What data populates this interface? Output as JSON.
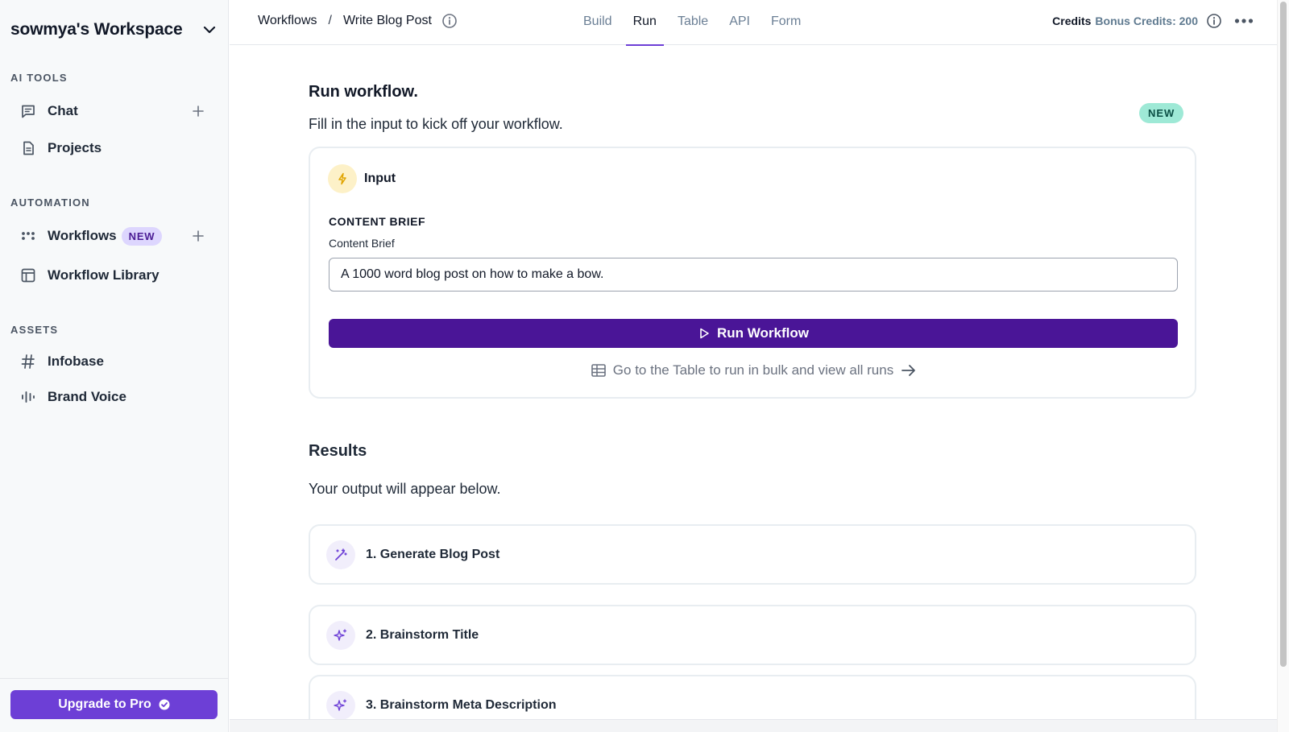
{
  "sidebar": {
    "workspace_name": "sowmya's Workspace",
    "sections": {
      "ai_tools": "AI TOOLS",
      "automation": "AUTOMATION",
      "assets": "ASSETS"
    },
    "items": {
      "chat": "Chat",
      "projects": "Projects",
      "workflows": "Workflows",
      "workflows_badge": "NEW",
      "workflow_library": "Workflow Library",
      "infobase": "Infobase",
      "brand_voice": "Brand Voice"
    },
    "upgrade_label": "Upgrade to Pro"
  },
  "header": {
    "breadcrumb": [
      "Workflows",
      "/",
      "Write Blog Post"
    ],
    "tabs": [
      "Build",
      "Run",
      "Table",
      "API",
      "Form"
    ],
    "active_tab": "Run",
    "credits_label": "Credits",
    "bonus_credits": "Bonus Credits: 200"
  },
  "main": {
    "run_title": "Run workflow.",
    "run_subtitle": "Fill in the input to kick off your workflow.",
    "new_badge": "NEW",
    "input_card": {
      "title": "Input",
      "section_label": "CONTENT BRIEF",
      "field_label": "Content Brief",
      "field_value": "A 1000 word blog post on how to make a bow."
    },
    "run_button_label": "Run Workflow",
    "table_link_label": "Go to the Table to run in bulk and view all runs",
    "results_title": "Results",
    "results_subtitle": "Your output will appear below.",
    "steps": [
      "1. Generate Blog Post",
      "2. Brainstorm Title",
      "3. Brainstorm Meta Description"
    ]
  },
  "colors": {
    "accent": "#6d3fd6",
    "run_button": "#4a1597",
    "new_badge_bg": "#9ee9d6"
  },
  "icons": {
    "workspace_toggle": "chevron-down-icon",
    "chat": "chat-bubble-icon",
    "projects": "document-icon",
    "workflows": "dots-grid-icon",
    "workflow_library": "layout-icon",
    "infobase": "hash-icon",
    "brand_voice": "audio-bars-icon",
    "add": "plus-icon",
    "upgrade": "verified-check-icon",
    "info": "info-icon",
    "more": "more-horizontal-icon",
    "input": "bolt-icon",
    "run": "play-icon",
    "table": "table-icon",
    "table_link_arrow": "arrow-right-icon",
    "step_generate": "magic-wand-icon",
    "step_brainstorm": "sparkle-icon"
  }
}
